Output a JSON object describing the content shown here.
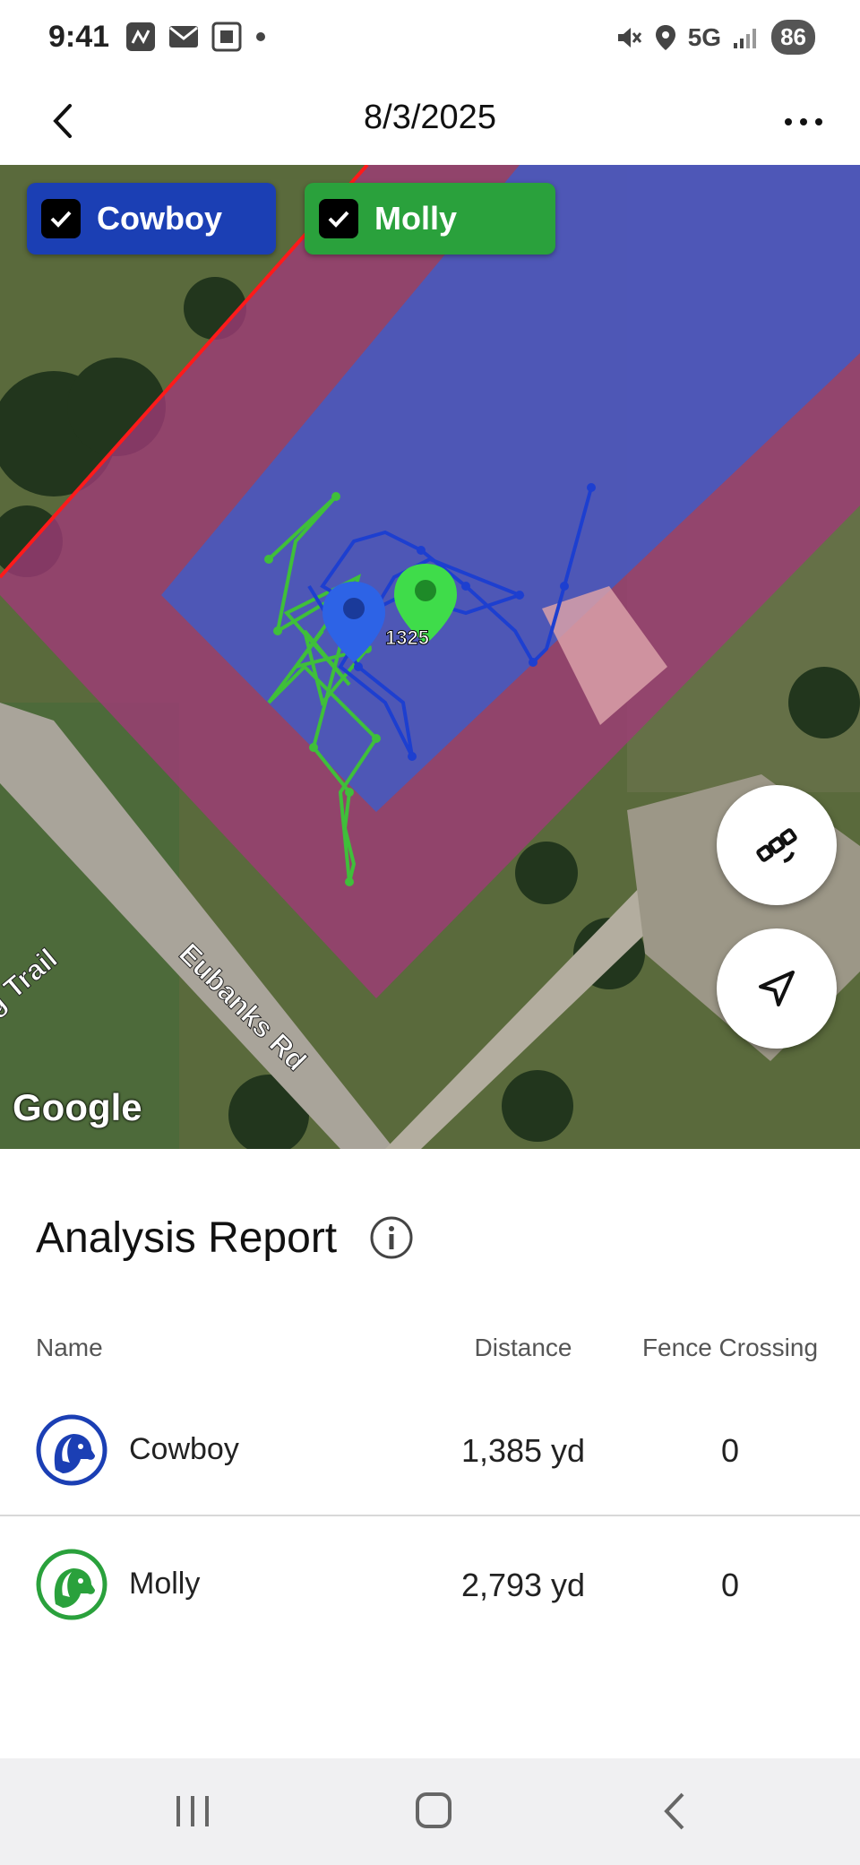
{
  "status_bar": {
    "time": "9:41",
    "network": "5G",
    "battery": "86"
  },
  "header": {
    "title": "8/3/2025"
  },
  "map": {
    "chips": [
      {
        "label": "Cowboy",
        "color": "#1b3fb4"
      },
      {
        "label": "Molly",
        "color": "#2aa13c"
      }
    ],
    "marker_label": "1325",
    "street_labels": {
      "road": "Eubanks Rd",
      "trail": "g Trail"
    },
    "attribution": "Google",
    "fabs": [
      {
        "icon": "satellite-icon"
      },
      {
        "icon": "navigation-arrow-icon"
      }
    ]
  },
  "report": {
    "title": "Analysis Report",
    "columns": {
      "name": "Name",
      "distance": "Distance",
      "fence": "Fence Crossing"
    },
    "rows": [
      {
        "name": "Cowboy",
        "distance": "1,385 yd",
        "fence": "0",
        "color": "#1b3fb4"
      },
      {
        "name": "Molly",
        "distance": "2,793 yd",
        "fence": "0",
        "color": "#2aa13c"
      }
    ]
  }
}
